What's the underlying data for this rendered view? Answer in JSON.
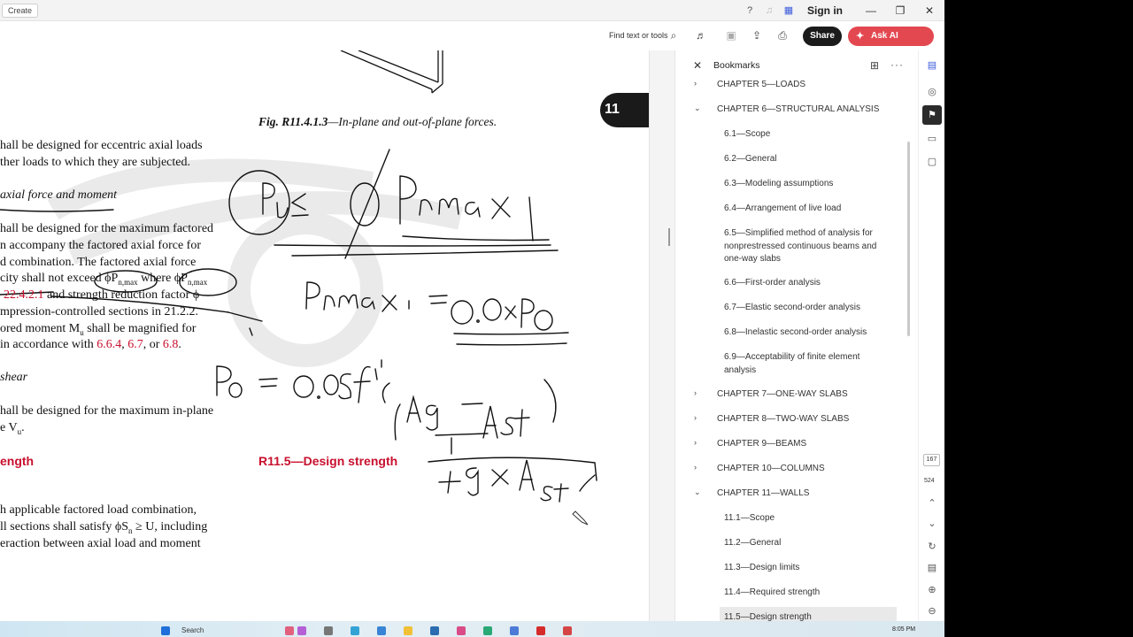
{
  "titlebar": {
    "create_label": "Create",
    "signin_label": "Sign in"
  },
  "toolbar": {
    "find_label": "Find text or tools",
    "share_label": "Share",
    "ai_label": "Ask AI Assistant"
  },
  "document": {
    "fig_caption_bold": "Fig. R11.4.1.3",
    "fig_caption_rest": "—In-plane and out-of-plane forces.",
    "page_number": "11",
    "lines": [
      "hall be designed for eccentric axial loads",
      "ther loads to which they are subjected.",
      "axial force and moment",
      "hall be designed for the maximum factored",
      "n accompany the factored axial force for",
      "d combination. The factored axial force",
      "city shall not exceed ϕP",
      "where ϕP",
      "22.4.2.1",
      "and strength reduction factor ϕ",
      "mpression-controlled sections in 21.2.2.",
      "ored moment M",
      "shall be magnified for",
      "in accordance with",
      "6.6.4",
      "6.7",
      "6.8",
      "shear",
      "hall be designed for the maximum in-plane",
      "e V",
      "h applicable factored load combination,",
      "ll sections shall satisfy ϕS",
      "≥ U, including",
      "eraction between axial load and moment"
    ],
    "sec_head_left": "ength",
    "sec_head_right": "R11.5—Design strength",
    "handwriting": {
      "eq1": "Pu ≤ ϕ Pn max",
      "eq2": "Pn max = 0.8 × Po",
      "eq3": "Po = 0.85 f'c (Ag − Ast)",
      "eq4": "+ fy × Ast"
    }
  },
  "bookmarks": {
    "title": "Bookmarks",
    "items": [
      {
        "label": "CHAPTER 5—LOADS",
        "level": "chapter"
      },
      {
        "label": "CHAPTER 6—STRUCTURAL ANALYSIS",
        "level": "chapter"
      },
      {
        "label": "6.1—Scope",
        "level": "sub"
      },
      {
        "label": "6.2—General",
        "level": "sub"
      },
      {
        "label": "6.3—Modeling assumptions",
        "level": "sub"
      },
      {
        "label": "6.4—Arrangement of live load",
        "level": "sub"
      },
      {
        "label": "6.5—Simplified method of analysis for nonprestressed continuous beams and one-way slabs",
        "level": "sub"
      },
      {
        "label": "6.6—First-order analysis",
        "level": "sub"
      },
      {
        "label": "6.7—Elastic second-order analysis",
        "level": "sub"
      },
      {
        "label": "6.8—Inelastic second-order analysis",
        "level": "sub"
      },
      {
        "label": "6.9—Acceptability of finite element analysis",
        "level": "sub"
      },
      {
        "label": "CHAPTER 7—ONE-WAY SLABS",
        "level": "chapter"
      },
      {
        "label": "CHAPTER 8—TWO-WAY SLABS",
        "level": "chapter"
      },
      {
        "label": "CHAPTER 9—BEAMS",
        "level": "chapter"
      },
      {
        "label": "CHAPTER 10—COLUMNS",
        "level": "chapter"
      },
      {
        "label": "CHAPTER 11—WALLS",
        "level": "chapter"
      },
      {
        "label": "11.1—Scope",
        "level": "sub"
      },
      {
        "label": "11.2—General",
        "level": "sub"
      },
      {
        "label": "11.3—Design limits",
        "level": "sub"
      },
      {
        "label": "11.4—Required strength",
        "level": "sub"
      },
      {
        "label": "11.5—Design strength",
        "level": "sub"
      }
    ]
  },
  "rail": {
    "current_page": "167",
    "total_pages": "524"
  },
  "taskbar": {
    "search_label": "Search",
    "time": "8:05 PM"
  },
  "colors": {
    "accent_red": "#c8102e",
    "ai_button": "#e34850",
    "share_button": "#1b1b1b"
  }
}
